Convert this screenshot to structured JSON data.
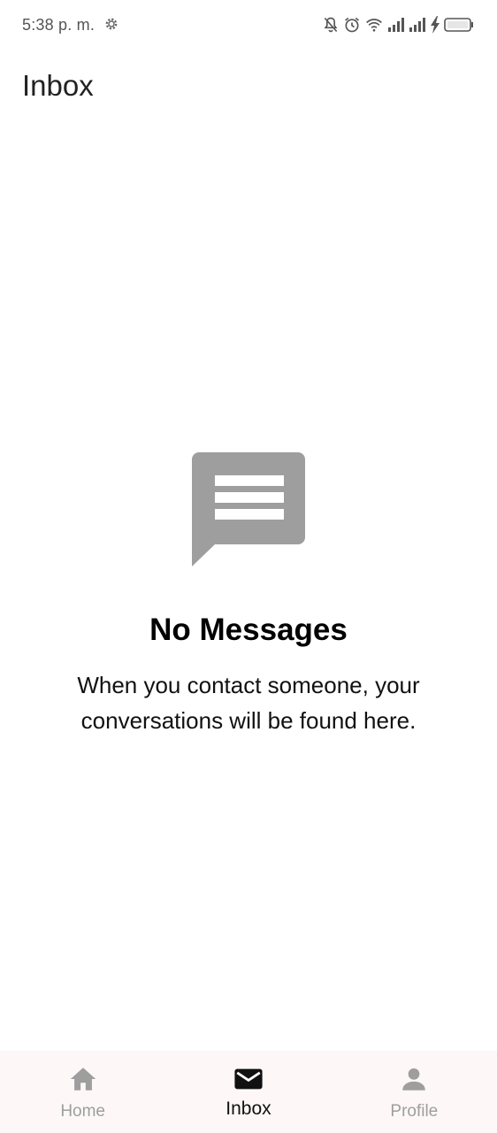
{
  "status_bar": {
    "time": "5:38 p. m.",
    "icons": [
      "settings-gear-icon",
      "mute-notifications-icon",
      "alarm-icon",
      "wifi-icon",
      "signal-icon",
      "signal-icon",
      "charging-icon",
      "battery-icon"
    ]
  },
  "header": {
    "title": "Inbox"
  },
  "empty_state": {
    "icon": "message-icon",
    "title": "No Messages",
    "text": "When you contact someone, your conversations will be found here."
  },
  "bottom_nav": {
    "items": [
      {
        "label": "Home",
        "icon": "home-icon",
        "active": false
      },
      {
        "label": "Inbox",
        "icon": "mail-icon",
        "active": true
      },
      {
        "label": "Profile",
        "icon": "person-icon",
        "active": false
      }
    ]
  },
  "colors": {
    "icon_gray": "#9e9e9e",
    "active": "#111111",
    "nav_background": "#fdf7f7"
  }
}
